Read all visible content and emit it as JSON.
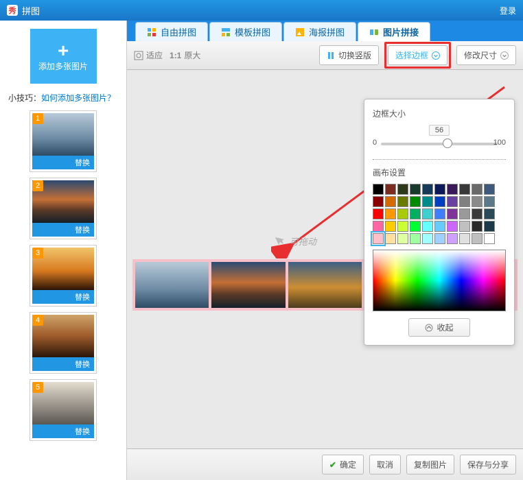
{
  "titlebar": {
    "app_name": "拼图",
    "login": "登录"
  },
  "sidebar": {
    "add_label": "添加多张图片",
    "tip_prefix": "小技巧：",
    "tip_link": "如何添加多张图片？",
    "replace_label": "替换",
    "thumbs": [
      {
        "num": "1",
        "cls": "pic-ship"
      },
      {
        "num": "2",
        "cls": "pic-sunset"
      },
      {
        "num": "3",
        "cls": "pic-sail"
      },
      {
        "num": "4",
        "cls": "pic-sail-dawn"
      },
      {
        "num": "5",
        "cls": "pic-boats"
      }
    ]
  },
  "tabs": {
    "t1": "自由拼图",
    "t2": "模板拼图",
    "t3": "海报拼图",
    "t4": "图片拼接"
  },
  "toolbar": {
    "fit": "适应",
    "orig": "原大",
    "vert": "切换竖版",
    "border": "选择边框",
    "resize": "修改尺寸"
  },
  "canvas": {
    "drag_hint": "可拖动",
    "cells": [
      "pic-ship",
      "pic-sunset",
      "pic-sunset2",
      "pic-boats",
      "pic-boats"
    ]
  },
  "popover": {
    "size_title": "边框大小",
    "slider": {
      "min": "0",
      "max": "100",
      "value": "56"
    },
    "canvas_title": "画布设置",
    "swatch_rows": [
      [
        "#000000",
        "#7a2d1e",
        "#2c3a1a",
        "#1a3a2c",
        "#163a5a",
        "#0d1a5a",
        "#3a1a5a",
        "#393939",
        "#6a6a6a",
        "#3d5a7a"
      ],
      [
        "#8a0000",
        "#d46a00",
        "#6a7a00",
        "#008a00",
        "#008a8a",
        "#0040c0",
        "#6a40a0",
        "#808080",
        "#8a8a8a",
        "#5a7a8a"
      ],
      [
        "#ff0000",
        "#ff9900",
        "#a8cc00",
        "#00b060",
        "#40cfcf",
        "#4080ff",
        "#803399",
        "#999999",
        "#3a3a3a",
        "#2a4a5a"
      ],
      [
        "#ff66a3",
        "#ffcc00",
        "#ccff33",
        "#00ff33",
        "#66ffff",
        "#66ccff",
        "#cc66ff",
        "#c0c0c0",
        "#2a2a2a",
        "#1a3a4a"
      ],
      [
        "#ffc0cb",
        "#ffe0a0",
        "#e0ffa0",
        "#a0ffa0",
        "#a0ffff",
        "#a0d0ff",
        "#d0a0ff",
        "#e0e0e0",
        "#bfbfbf",
        "#ffffff"
      ]
    ],
    "selected_swatch": "4,0",
    "collapse": "收起"
  },
  "footer": {
    "ok": "确定",
    "cancel": "取消",
    "copy": "复制图片",
    "save": "保存与分享"
  }
}
